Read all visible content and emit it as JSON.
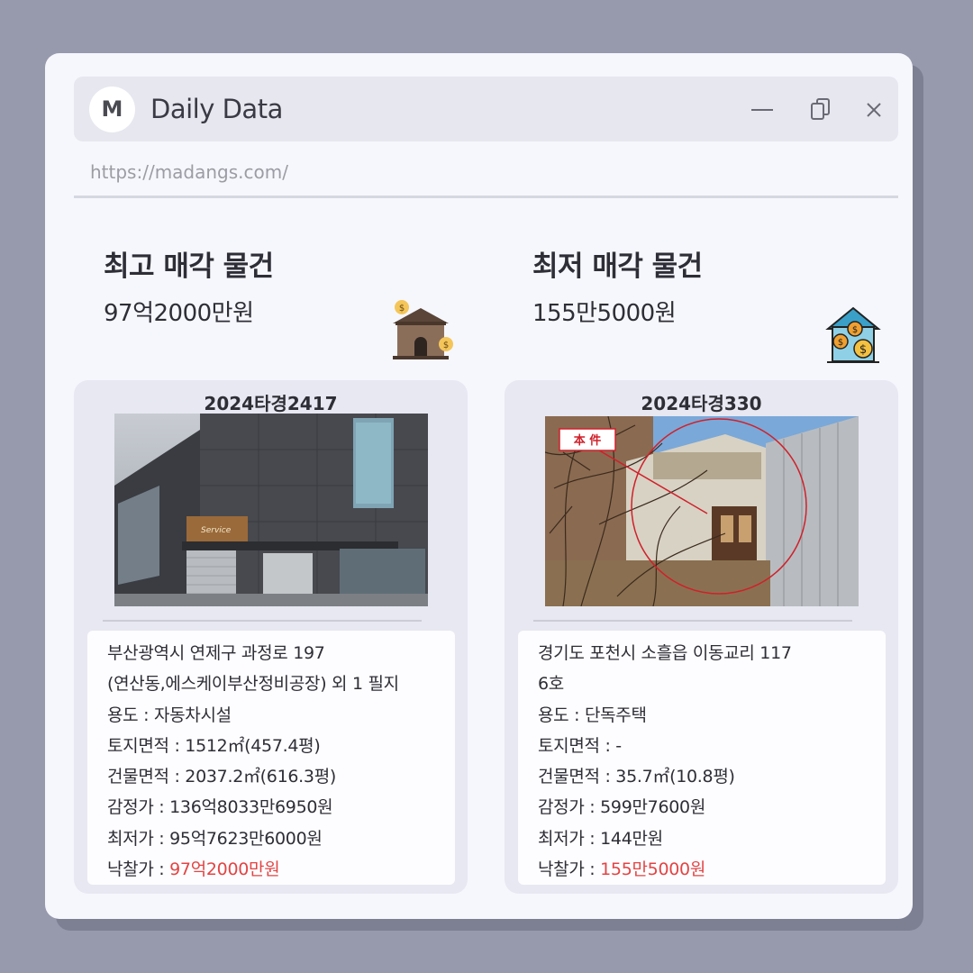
{
  "app": {
    "avatar_letter": "M",
    "title": "Daily Data",
    "url": "https://madangs.com/"
  },
  "left": {
    "heading": "최고 매각 물건",
    "price": "97억2000만원",
    "case_no": "2024타경2417",
    "photo_sign": "Service",
    "info": {
      "address_line1": "부산광역시 연제구 과정로 197",
      "address_line2": "(연산동,에스케이부산정비공장) 외 1 필지",
      "usage": "용도 : 자동차시설",
      "land_area": "토지면적 : 1512㎡(457.4평)",
      "building_area": "건물면적 : 2037.2㎡(616.3평)",
      "appraisal": "감정가 : 136억8033만6950원",
      "minimum": "최저가 : 95억7623만6000원",
      "winning_label": "낙찰가 : ",
      "winning_value": "97억2000만원"
    }
  },
  "right": {
    "heading": "최저 매각 물건",
    "price": "155만5000원",
    "case_no": "2024타경330",
    "photo_tag": "本 件",
    "info": {
      "address_line1": "경기도 포천시 소흘읍 이동교리 117",
      "address_line2": "6호",
      "usage": "용도 :  단독주택",
      "land_area": "토지면적 : -",
      "building_area": "건물면적 : 35.7㎡(10.8평)",
      "appraisal": "감정가 : 599만7600원",
      "minimum": "최저가 : 144만원",
      "winning_label": "낙찰가 : ",
      "winning_value": "155만5000원"
    }
  },
  "colors": {
    "accent_red": "#e34444",
    "background": "#9799ad",
    "window": "#f6f7fc",
    "card": "#e7e8f1"
  }
}
